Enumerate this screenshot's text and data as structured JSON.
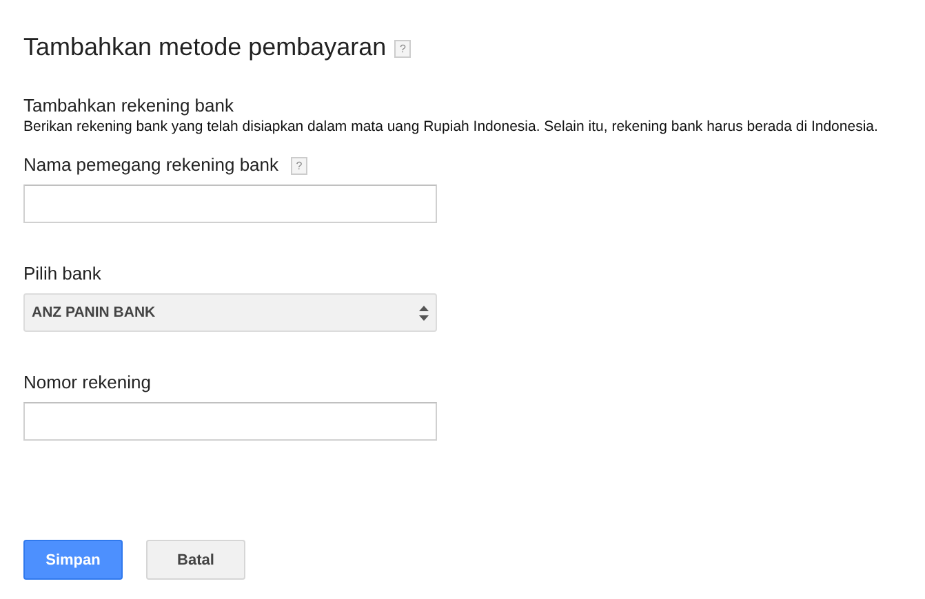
{
  "title": "Tambahkan metode pembayaran",
  "title_help": "?",
  "section": {
    "title": "Tambahkan rekening bank",
    "description": "Berikan rekening bank yang telah disiapkan dalam mata uang Rupiah Indonesia. Selain itu, rekening bank harus berada di Indonesia."
  },
  "fields": [
    {
      "kind": "input",
      "label": "Nama pemegang rekening bank",
      "help": "?"
    },
    {
      "kind": "select",
      "label": "Pilih bank",
      "value": "ANZ PANIN BANK"
    },
    {
      "kind": "input",
      "label": "Nomor rekening"
    }
  ],
  "buttons": [
    {
      "label": "Simpan",
      "kind": "primary"
    },
    {
      "label": "Batal",
      "kind": "secondary"
    }
  ]
}
